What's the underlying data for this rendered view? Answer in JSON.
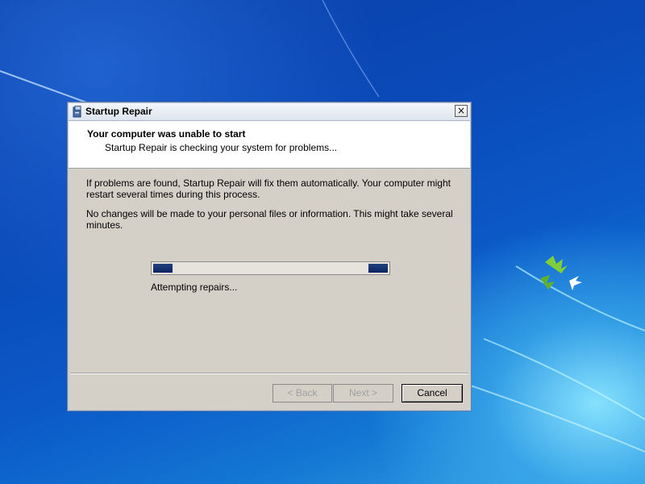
{
  "window": {
    "title": "Startup Repair",
    "close_glyph": "×"
  },
  "header": {
    "title": "Your computer was unable to start",
    "subtitle": "Startup Repair is checking your system for problems..."
  },
  "body": {
    "paragraph_1": "If problems are found, Startup Repair will fix them automatically. Your computer might restart several times during this process.",
    "paragraph_2": "No changes will be made to your personal files or information. This might take several minutes."
  },
  "progress": {
    "style": "indeterminate",
    "status": "Attempting repairs..."
  },
  "buttons": {
    "back": "< Back",
    "next": "Next >",
    "cancel": "Cancel"
  },
  "icons": {
    "window_icon": "startup-repair-icon",
    "close": "close-icon"
  },
  "colors": {
    "desktop_blue": "#0a4ab8",
    "dialog_face": "#d4d0c8",
    "progress_fill": "#0d2360"
  }
}
